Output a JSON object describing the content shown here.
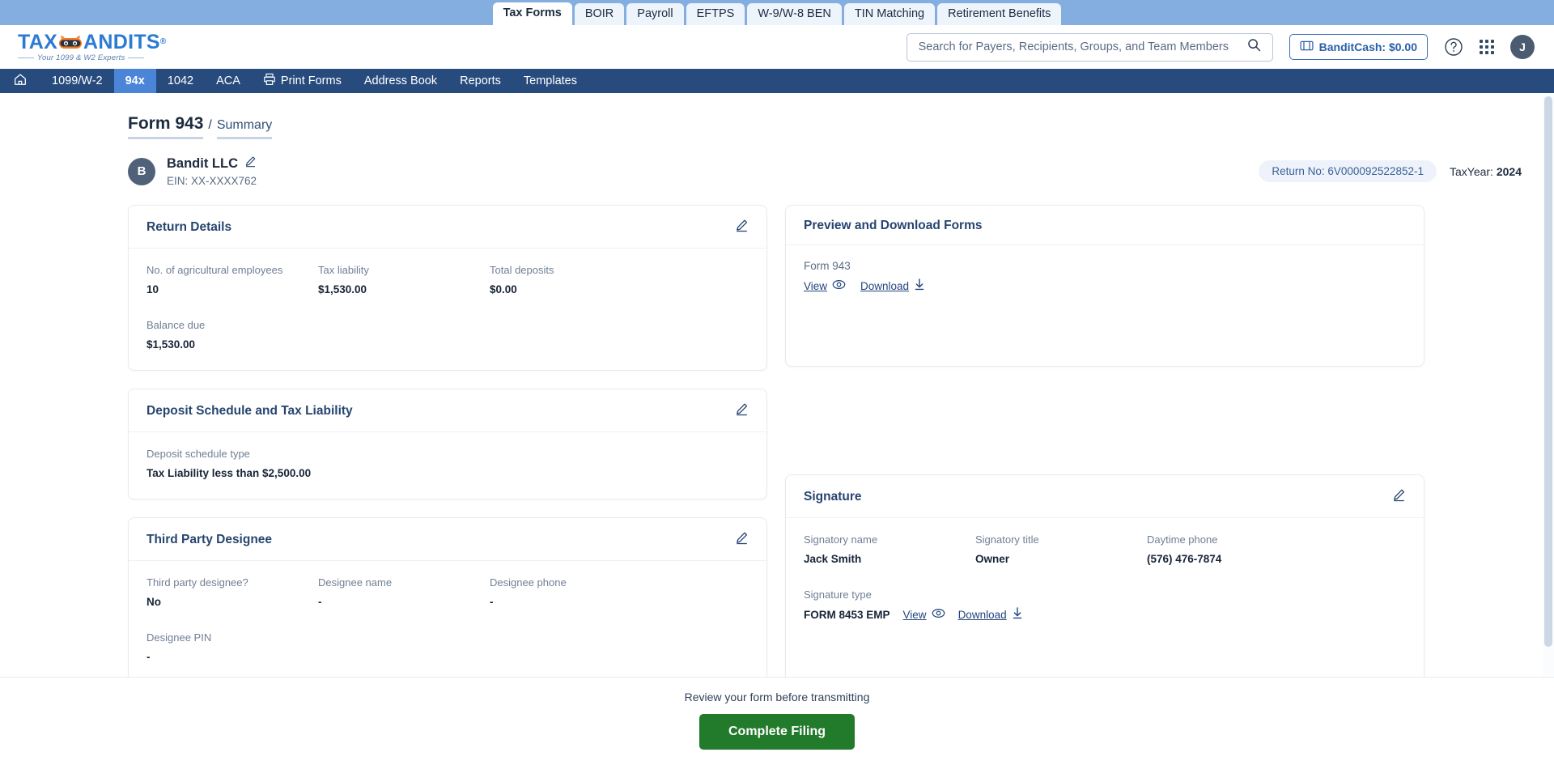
{
  "product_tabs": [
    {
      "label": "Tax Forms",
      "active": true
    },
    {
      "label": "BOIR",
      "active": false
    },
    {
      "label": "Payroll",
      "active": false
    },
    {
      "label": "EFTPS",
      "active": false
    },
    {
      "label": "W-9/W-8 BEN",
      "active": false
    },
    {
      "label": "TIN Matching",
      "active": false
    },
    {
      "label": "Retirement Benefits",
      "active": false
    }
  ],
  "brand": {
    "name_part1": "TAX",
    "name_part2": "ANDITS",
    "registered": "®",
    "tagline": "Your 1099 & W2 Experts"
  },
  "header": {
    "search_placeholder": "Search for Payers, Recipients, Groups, and Team Members",
    "search_value": "",
    "search_icon": "search-icon",
    "bandit_cash_label": "BanditCash: $0.00",
    "help_icon": "question-circle-icon",
    "apps_icon": "apps-grid-icon",
    "avatar_initial": "J"
  },
  "nav": [
    {
      "label": "",
      "icon": "home-icon",
      "active": false
    },
    {
      "label": "1099/W-2",
      "active": false
    },
    {
      "label": "94x",
      "active": true
    },
    {
      "label": "1042",
      "active": false
    },
    {
      "label": "ACA",
      "active": false
    },
    {
      "label": "Print Forms",
      "icon": "printer-icon",
      "active": false
    },
    {
      "label": "Address Book",
      "active": false
    },
    {
      "label": "Reports",
      "active": false
    },
    {
      "label": "Templates",
      "active": false
    }
  ],
  "breadcrumb": {
    "form": "Form 943",
    "separator": "/",
    "page": "Summary"
  },
  "payer": {
    "avatar_initial": "B",
    "name": "Bandit LLC",
    "ein": "EIN: XX-XXXX762",
    "edit_icon": "pencil-icon"
  },
  "return_meta": {
    "return_no": "Return No: 6V000092522852-1",
    "tax_year_label": "TaxYear:",
    "tax_year_value": "2024"
  },
  "cards": {
    "return_details": {
      "title": "Return Details",
      "fields": [
        {
          "label": "No. of agricultural employees",
          "value": "10"
        },
        {
          "label": "Tax liability",
          "value": "$1,530.00"
        },
        {
          "label": "Total deposits",
          "value": "$0.00"
        },
        {
          "label": "Balance due",
          "value": "$1,530.00"
        }
      ]
    },
    "deposit_schedule": {
      "title": "Deposit Schedule and Tax Liability",
      "fields": [
        {
          "label": "Deposit schedule type",
          "value": "Tax Liability less than $2,500.00"
        }
      ]
    },
    "third_party": {
      "title": "Third Party Designee",
      "fields": [
        {
          "label": "Third party designee?",
          "value": "No"
        },
        {
          "label": "Designee name",
          "value": "-"
        },
        {
          "label": "Designee phone",
          "value": "-"
        },
        {
          "label": "Designee PIN",
          "value": "-"
        }
      ]
    },
    "preview_download": {
      "title": "Preview and Download Forms",
      "form_label": "Form 943",
      "view_label": "View",
      "download_label": "Download"
    },
    "signature": {
      "title": "Signature",
      "fields": [
        {
          "label": "Signatory name",
          "value": "Jack Smith"
        },
        {
          "label": "Signatory title",
          "value": "Owner"
        },
        {
          "label": "Daytime phone",
          "value": "(576) 476-7874"
        }
      ],
      "signature_type_label": "Signature type",
      "signature_type_value": "FORM 8453 EMP",
      "view_label": "View",
      "download_label": "Download"
    }
  },
  "footer": {
    "note": "Review your form before transmitting",
    "complete_button": "Complete Filing"
  },
  "colors": {
    "nav_bg": "#284b7e",
    "nav_active": "#4a85d8",
    "strip_bg": "#85aee0",
    "brand_blue": "#2d7ad4",
    "card_title": "#27456f",
    "complete_green": "#227a2b",
    "pill_bg": "#eef3fb"
  }
}
